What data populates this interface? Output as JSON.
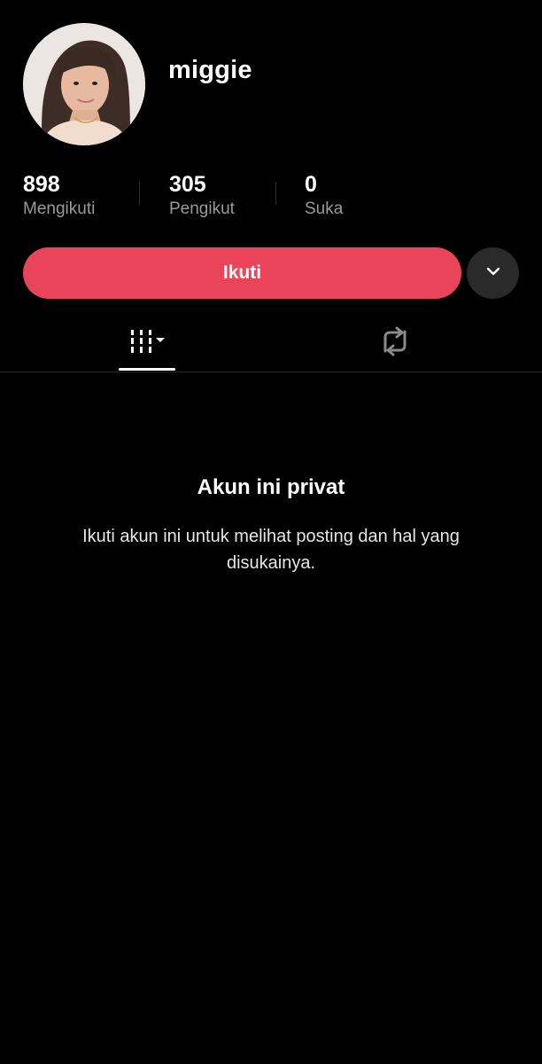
{
  "profile": {
    "username": "miggie",
    "avatar_icon": "profile-photo"
  },
  "stats": [
    {
      "value": "898",
      "label": "Mengikuti"
    },
    {
      "value": "305",
      "label": "Pengikut"
    },
    {
      "value": "0",
      "label": "Suka"
    }
  ],
  "actions": {
    "follow_label": "Ikuti",
    "follow_color": "#ea445a",
    "more_icon": "chevron-down-icon"
  },
  "tabs": [
    {
      "name": "videos",
      "icon": "grid-filter-icon",
      "active": true
    },
    {
      "name": "reposts",
      "icon": "repost-icon",
      "active": false
    }
  ],
  "private_notice": {
    "title": "Akun ini privat",
    "description": "Ikuti akun ini untuk melihat posting dan hal yang disukainya."
  }
}
